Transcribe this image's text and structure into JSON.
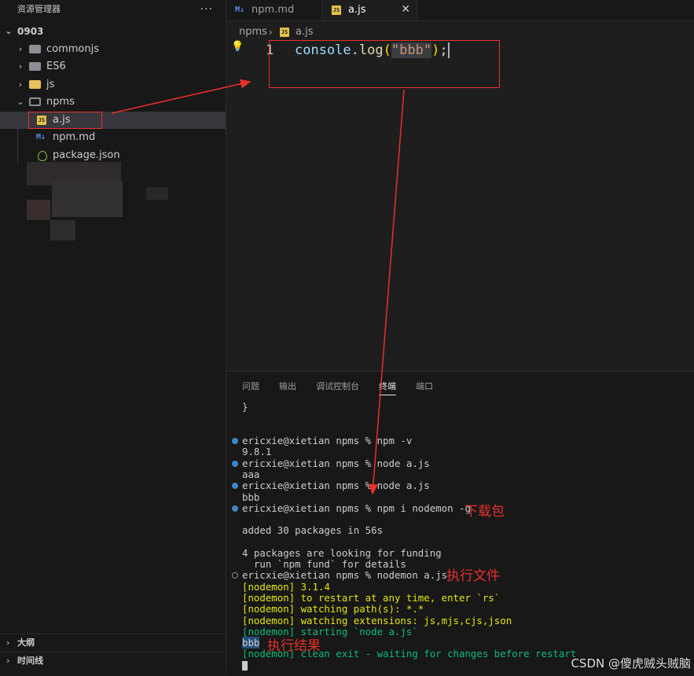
{
  "explorer": {
    "title": "资源管理器",
    "more": "···",
    "root": "0903",
    "items": [
      {
        "label": "commonjs"
      },
      {
        "label": "ES6"
      },
      {
        "label": "js"
      },
      {
        "label": "npms"
      },
      {
        "label": "a.js"
      },
      {
        "label": "npm.md"
      },
      {
        "label": "package.json"
      }
    ],
    "outline": "大纲",
    "timeline": "时间线"
  },
  "tabs": [
    {
      "label": "npm.md",
      "icon": "markdown-icon"
    },
    {
      "label": "a.js",
      "icon": "js-file-icon",
      "active": true,
      "close": "✕"
    }
  ],
  "breadcrumb": {
    "folder": "npms",
    "file": "a.js"
  },
  "editor": {
    "line_number": "1",
    "tokens": {
      "obj": "console",
      "dot": ".",
      "fn": "log",
      "open": "(",
      "str": "\"bbb\"",
      "close": ")",
      "semi": ";"
    }
  },
  "panel": {
    "tabs": [
      "问题",
      "输出",
      "调试控制台",
      "终端",
      "端口"
    ],
    "active_tab": "终端"
  },
  "terminal": {
    "l0": "}",
    "l1": "ericxie@xietian npms % npm -v",
    "l2": "9.8.1",
    "l3": "ericxie@xietian npms % node a.js",
    "l4": "aaa",
    "l5": "ericxie@xietian npms % node a.js",
    "l6": "bbb",
    "l7": "ericxie@xietian npms % npm i nodemon -g",
    "l8": "added 30 packages in 56s",
    "l9": "4 packages are looking for funding",
    "l10": "  run `npm fund` for details",
    "l11": "ericxie@xietian npms % nodemon a.js",
    "l12": "[nodemon] 3.1.4",
    "l13": "[nodemon] to restart at any time, enter `rs`",
    "l14": "[nodemon] watching path(s): *.*",
    "l15": "[nodemon] watching extensions: js,mjs,cjs,json",
    "l16": "[nodemon] starting `node a.js`",
    "l17": "bbb",
    "l18": "[nodemon] clean exit - waiting for changes before restart"
  },
  "annotations": {
    "download": "下载包",
    "run_file": "执行文件",
    "result": "执行结果"
  },
  "watermark": "CSDN @傻虎贼头贼脑",
  "colors": {
    "annotation_red": "#e8302a",
    "nodemon_yellow": "#e5e510",
    "nodemon_green": "#0dbc79",
    "js_yellow": "#e3c24a"
  }
}
